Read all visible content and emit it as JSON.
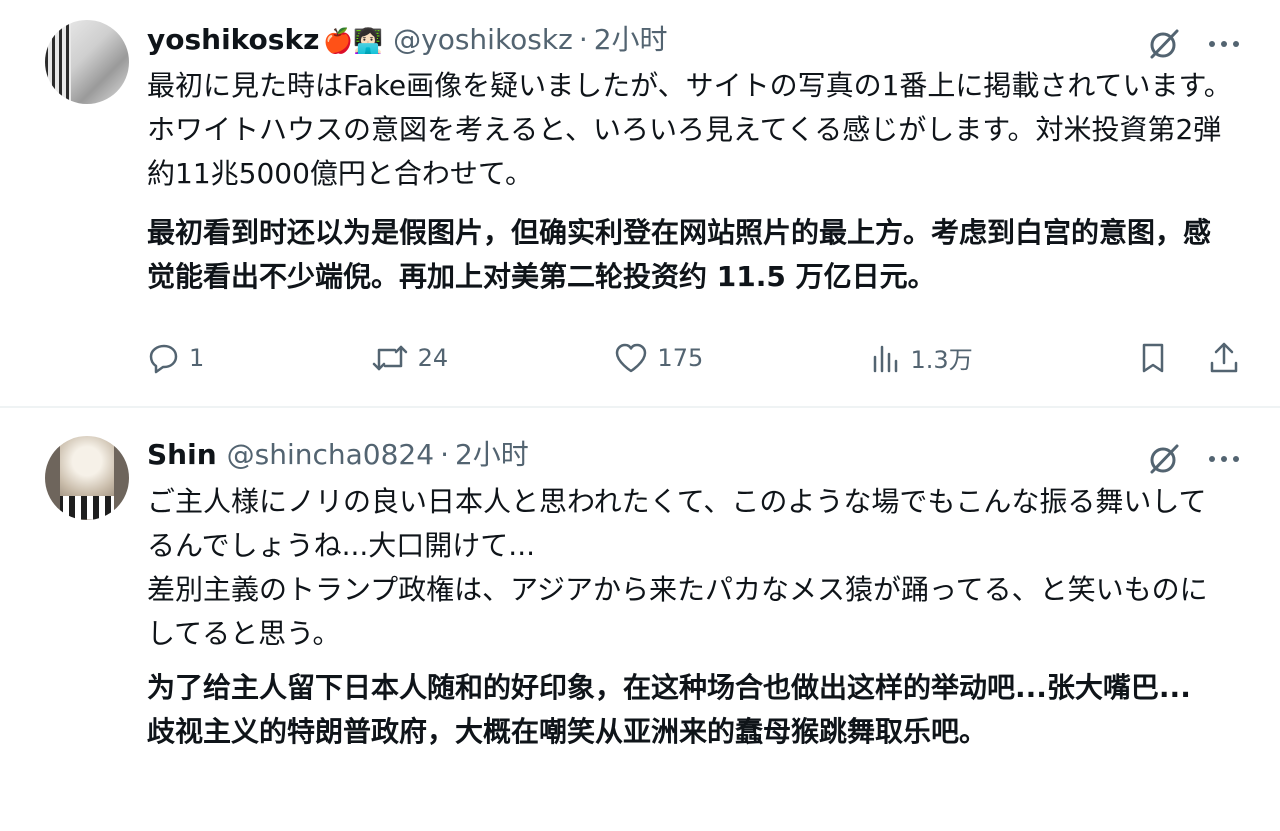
{
  "tweets": [
    {
      "display_name": "yoshikoskz",
      "badge": "🍎👩🏻‍💻",
      "handle": "@yoshikoskz",
      "separator": "·",
      "time": "2小时",
      "text_jp": "最初に見た時はFake画像を疑いましたが、サイトの写真の1番上に掲載されています。ホワイトハウスの意図を考えると、いろいろ見えてくる感じがします。対米投資第2弾約11兆5000億円と合わせて。",
      "text_cn": "最初看到时还以为是假图片，但确实利登在网站照片的最上方。考虑到白宫的意图，感觉能看出不少端倪。再加上对美第二轮投资约 11.5 万亿日元。",
      "replies": "1",
      "reposts": "24",
      "likes": "175",
      "views": "1.3万"
    },
    {
      "display_name": "Shin",
      "handle": "@shincha0824",
      "separator": "·",
      "time": "2小时",
      "text_jp_1": "ご主人様にノリの良い日本人と思われたくて、このような場でもこんな振る舞いしてるんでしょうね...大口開けて...",
      "text_jp_2": "差別主義のトランプ政権は、アジアから来たパカなメス猿が踊ってる、と笑いものにしてると思う。",
      "text_cn_1": "为了给主人留下日本人随和的好印象，在这种场合也做出这样的举动吧...张大嘴巴...",
      "text_cn_2": "歧视主义的特朗普政府，大概在嘲笑从亚洲来的蠢母猴跳舞取乐吧。"
    }
  ],
  "icons": {
    "grok": "grok-icon",
    "more": "more-icon",
    "reply": "reply-icon",
    "repost": "repost-icon",
    "like": "like-icon",
    "views": "views-icon",
    "bookmark": "bookmark-icon",
    "share": "share-icon"
  },
  "colors": {
    "text": "#0f1419",
    "secondary": "#536471",
    "divider": "#eff3f4"
  }
}
